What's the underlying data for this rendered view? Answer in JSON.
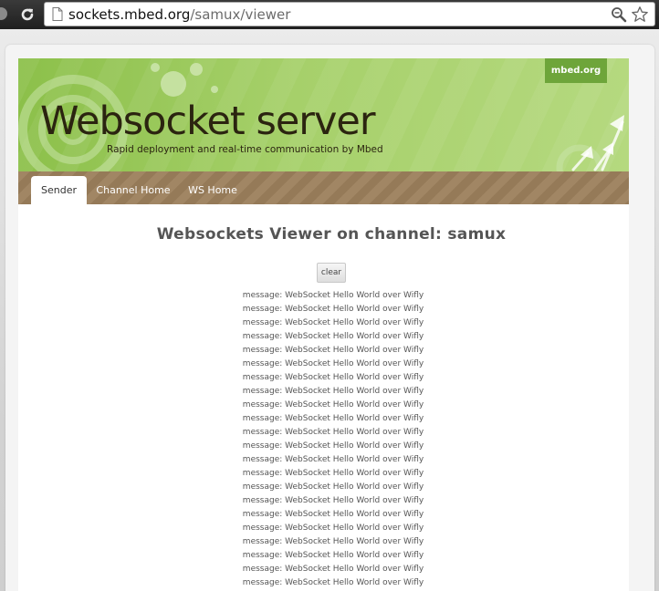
{
  "browser": {
    "url_host": "sockets.mbed.org",
    "url_path": "/samux/viewer"
  },
  "header": {
    "badge": "mbed.org",
    "title": "Websocket server",
    "tagline": "Rapid deployment and real-time communication by Mbed"
  },
  "nav": {
    "tabs": [
      {
        "label": "Sender"
      },
      {
        "label": "Channel Home"
      },
      {
        "label": "WS Home"
      }
    ]
  },
  "main": {
    "title": "Websockets Viewer on channel: samux",
    "clear_label": "clear",
    "messages": [
      "message: WebSocket Hello World over Wifly",
      "message: WebSocket Hello World over Wifly",
      "message: WebSocket Hello World over Wifly",
      "message: WebSocket Hello World over Wifly",
      "message: WebSocket Hello World over Wifly",
      "message: WebSocket Hello World over Wifly",
      "message: WebSocket Hello World over Wifly",
      "message: WebSocket Hello World over Wifly",
      "message: WebSocket Hello World over Wifly",
      "message: WebSocket Hello World over Wifly",
      "message: WebSocket Hello World over Wifly",
      "message: WebSocket Hello World over Wifly",
      "message: WebSocket Hello World over Wifly",
      "message: WebSocket Hello World over Wifly",
      "message: WebSocket Hello World over Wifly",
      "message: WebSocket Hello World over Wifly",
      "message: WebSocket Hello World over Wifly",
      "message: WebSocket Hello World over Wifly",
      "message: WebSocket Hello World over Wifly",
      "message: WebSocket Hello World over Wifly",
      "message: WebSocket Hello World over Wifly",
      "message: WebSocket Hello World over Wifly"
    ]
  }
}
